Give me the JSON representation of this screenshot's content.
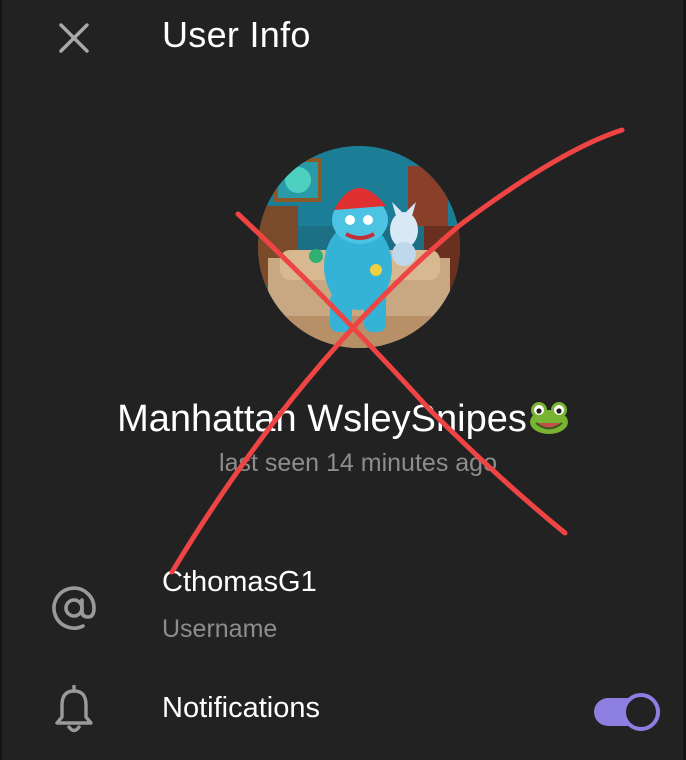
{
  "header": {
    "title": "User Info",
    "close_icon": "close-icon"
  },
  "profile": {
    "name": "Manhattan WsleySnipes",
    "name_emoji": "frog-face",
    "status": "last seen 14 minutes ago"
  },
  "username": {
    "icon": "at-sign-icon",
    "value": "CthomasG1",
    "label": "Username"
  },
  "notifications": {
    "icon": "bell-icon",
    "label": "Notifications",
    "enabled": true
  },
  "colors": {
    "background": "#222222",
    "accent": "#8d7ee2",
    "secondary_text": "#8d8d8d",
    "overlay_mark": "#ee4444"
  }
}
